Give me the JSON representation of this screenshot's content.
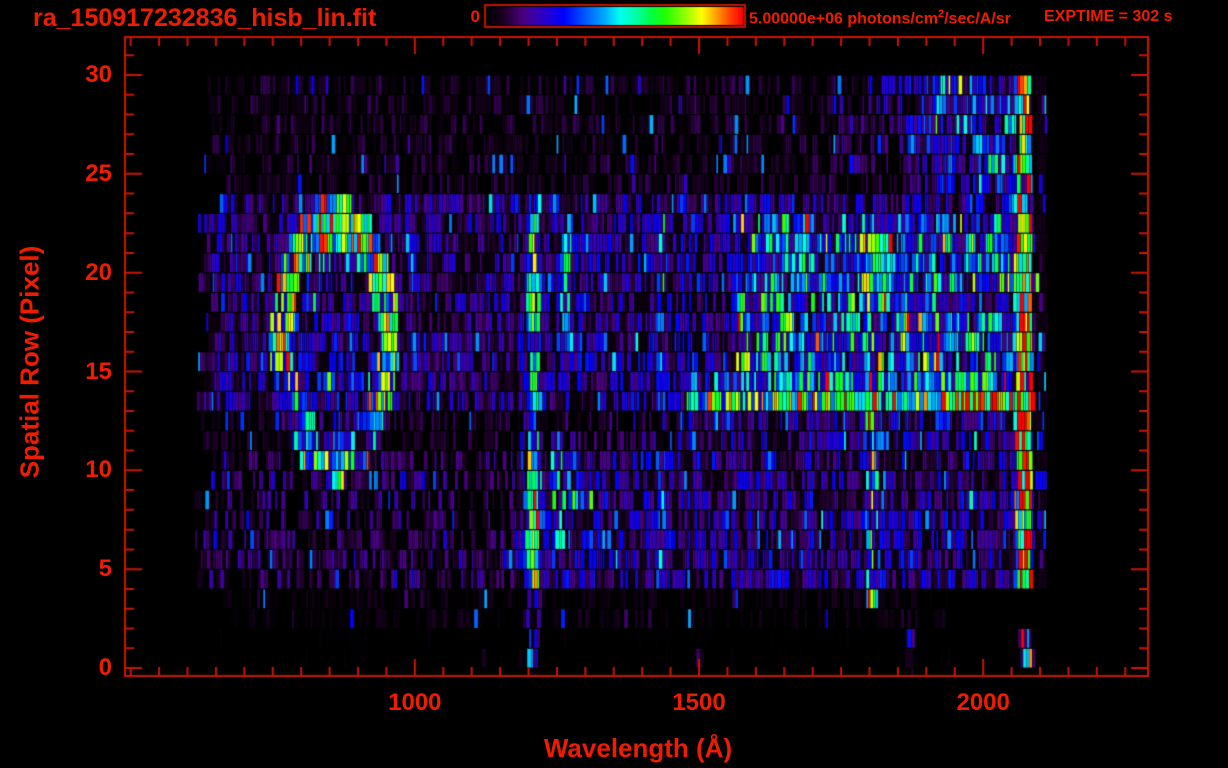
{
  "header": {
    "title": "ra_150917232836_hisb_lin.fit",
    "exptime_label": "EXPTIME = 302 s"
  },
  "colorbar": {
    "min_label": "0",
    "max_value_prefix": "5.00000e+06 photons/cm",
    "max_value_sup": "2",
    "max_value_suffix": "/sec/A/sr"
  },
  "chart_data": {
    "type": "heatmap",
    "title": "ra_150917232836_hisb_lin.fit",
    "xlabel": "Wavelength (Å)",
    "ylabel": "Spatial Row (Pixel)",
    "x_range": [
      490,
      2290
    ],
    "y_range": [
      -0.4,
      31.9
    ],
    "x_ticks_major": [
      1000,
      1500,
      2000
    ],
    "x_tick_minor_step": 50,
    "y_ticks_major": [
      0,
      5,
      10,
      15,
      20,
      25,
      30
    ],
    "y_tick_minor_step": 1,
    "grid": false,
    "legend": "colorbar-top",
    "intensity_scale": {
      "min": 0,
      "max": 5000000,
      "units": "photons/cm^2/sec/A/sr"
    },
    "exposure_time_s": 302,
    "data_extent": {
      "wavelength": [
        620,
        2110
      ],
      "rows": [
        0,
        30
      ]
    },
    "colors": {
      "background": "#000000",
      "text_red": "#ee1c00",
      "axis_red": "#cc1400",
      "colorbar_border": "#bb1400"
    },
    "colormap_stops": [
      [
        0.0,
        "#000000"
      ],
      [
        0.06,
        "#1a0022"
      ],
      [
        0.14,
        "#4b0082"
      ],
      [
        0.22,
        "#2a00c8"
      ],
      [
        0.3,
        "#0000ff"
      ],
      [
        0.38,
        "#0055ff"
      ],
      [
        0.46,
        "#00aaff"
      ],
      [
        0.52,
        "#00ffee"
      ],
      [
        0.58,
        "#00ffaa"
      ],
      [
        0.64,
        "#00ff44"
      ],
      [
        0.7,
        "#22ff00"
      ],
      [
        0.78,
        "#99ff00"
      ],
      [
        0.84,
        "#ffff00"
      ],
      [
        0.9,
        "#ff9900"
      ],
      [
        0.95,
        "#ff4400"
      ],
      [
        1.0,
        "#ff0000"
      ]
    ],
    "features": [
      {
        "name": "noise-floor-top-rows",
        "shape": "region",
        "rows": [
          24,
          30.5
        ],
        "wl": [
          620,
          2090
        ],
        "level": 0.06
      },
      {
        "name": "background-mid-rows",
        "shape": "region",
        "rows": [
          13.5,
          24
        ],
        "wl": [
          612,
          2090
        ],
        "level": 0.15
      },
      {
        "name": "background-lower-rows",
        "shape": "region",
        "rows": [
          5,
          13.5
        ],
        "wl": [
          612,
          2090
        ],
        "level": 0.11
      },
      {
        "name": "post-lya-brightening",
        "shape": "region",
        "rows": [
          5,
          24
        ],
        "wl": [
          1185,
          2090
        ],
        "level": 0.18
      },
      {
        "name": "upper-right-enhancement",
        "shape": "region",
        "rows": [
          14.5,
          23.5
        ],
        "wl": [
          1560,
          2088
        ],
        "level": 0.36,
        "patch": 0.26
      },
      {
        "name": "faint-bottom-rows",
        "shape": "region",
        "rows": [
          2.6,
          5
        ],
        "wl": [
          650,
          1950
        ],
        "level": 0.035
      },
      {
        "name": "sparse-floor-rows-0-2",
        "shape": "region",
        "rows": [
          0,
          2.6
        ],
        "wl": [
          640,
          1960
        ],
        "level": 0.012
      },
      {
        "name": "pre-edge-bright-column",
        "shape": "region",
        "rows": [
          5,
          23.5
        ],
        "wl": [
          2056,
          2086
        ],
        "level": 0.55,
        "patch": 0.2
      },
      {
        "name": "post-edge-blue-dashes",
        "shape": "region",
        "rows": [
          2,
          30.5
        ],
        "wl": [
          2094,
          2112
        ],
        "level": 0.27
      },
      {
        "name": "top-rows-right-enhancement",
        "shape": "ramp",
        "rows": [
          24,
          30.5
        ],
        "wl": [
          1700,
          2088
        ],
        "level": [
          0.08,
          0.5
        ]
      },
      {
        "name": "dark-lane-rows-12-13",
        "shape": "suppress",
        "rows": [
          11.6,
          13.4
        ],
        "wl": [
          612,
          1465
        ],
        "factor": 0.62
      },
      {
        "name": "airglow-ring",
        "shape": "ring",
        "center_wl": 859,
        "center_row": 17.1,
        "wl_radius": 93,
        "row_radius": 5.9,
        "thickness": 0.22,
        "level": 0.55,
        "interior_level": 0.2,
        "top_blob": {
          "wl": 858,
          "row": 21.8,
          "wl_sigma": 50,
          "row_sigma": 1.3,
          "level": 0.62
        },
        "inner_dot": {
          "wl": 851,
          "row": 14.4,
          "wl_sigma": 25,
          "row_sigma": 0.8,
          "level": 0.5
        }
      },
      {
        "name": "lyman-alpha-emission",
        "shape": "line",
        "center_wl": 1210,
        "wl_sigma": 13,
        "rows": [
          5,
          24.5
        ],
        "level": 0.55,
        "below_rows_level": 0.2,
        "segments": [
          {
            "rows": [
              5.8,
              12.2
            ],
            "level": 0.8
          },
          {
            "rows": [
              12.2,
              15
            ],
            "level": 0.62
          }
        ],
        "hotspots": [
          {
            "row": 7.6,
            "sigma": 0.75,
            "level": 0.98
          },
          {
            "row": 9.7,
            "sigma": 0.7,
            "level": 0.95
          },
          {
            "row": 11.4,
            "sigma": 0.6,
            "level": 0.85
          }
        ]
      },
      {
        "name": "line-1255-lower",
        "shape": "line",
        "center_wl": 1255,
        "wl_sigma": 11,
        "rows": [
          5.5,
          12
        ],
        "level": 0.42
      },
      {
        "name": "bar-1255-1310",
        "shape": "region",
        "rows": [
          8.3,
          9.8
        ],
        "wl": [
          1243,
          1312
        ],
        "level": 0.42
      },
      {
        "name": "line-1266-upper",
        "shape": "line",
        "center_wl": 1266,
        "wl_sigma": 13,
        "rows": [
          16.5,
          23
        ],
        "level": 0.46,
        "hotspots": [
          {
            "row": 21.6,
            "sigma": 1.0,
            "level": 0.6
          }
        ]
      },
      {
        "name": "line-1433",
        "shape": "line",
        "center_wl": 1433,
        "wl_sigma": 10,
        "rows": [
          5,
          23
        ],
        "level": 0.32
      },
      {
        "name": "line-1805-lower",
        "shape": "line",
        "center_wl": 1805,
        "wl_sigma": 14,
        "rows": [
          4,
          13
        ],
        "level": 0.46
      },
      {
        "name": "line-1800-upper",
        "shape": "line",
        "center_wl": 1800,
        "wl_sigma": 12,
        "rows": [
          13,
          23.5
        ],
        "level": 0.58
      },
      {
        "name": "bright-band-row-14",
        "shape": "band",
        "row_center": 14.2,
        "row_sigma": 1.05,
        "wl": [
          1480,
          2090
        ],
        "level": [
          0.55,
          0.85
        ]
      },
      {
        "name": "long-wl-edge-strip",
        "shape": "edge",
        "wl": [
          2062,
          2085
        ],
        "rows": [
          0.5,
          30.5
        ],
        "level": [
          0.68,
          1.0
        ],
        "hot_rows": [
          13,
          15.5
        ]
      },
      {
        "name": "bottom-row-dashes",
        "shape": "dashes",
        "items": [
          {
            "wl": 1210,
            "rows": [
              0.5,
              2.6
            ],
            "level": 0.3
          },
          {
            "wl": 1501,
            "rows": [
              0.2,
              1.2
            ],
            "level": 0.3
          },
          {
            "wl": 1871,
            "rows": [
              0.2,
              2.2
            ],
            "level": 0.35
          },
          {
            "wl": 2082,
            "rows": [
              0.2,
              1.4
            ],
            "level": 0.8
          }
        ]
      }
    ]
  }
}
